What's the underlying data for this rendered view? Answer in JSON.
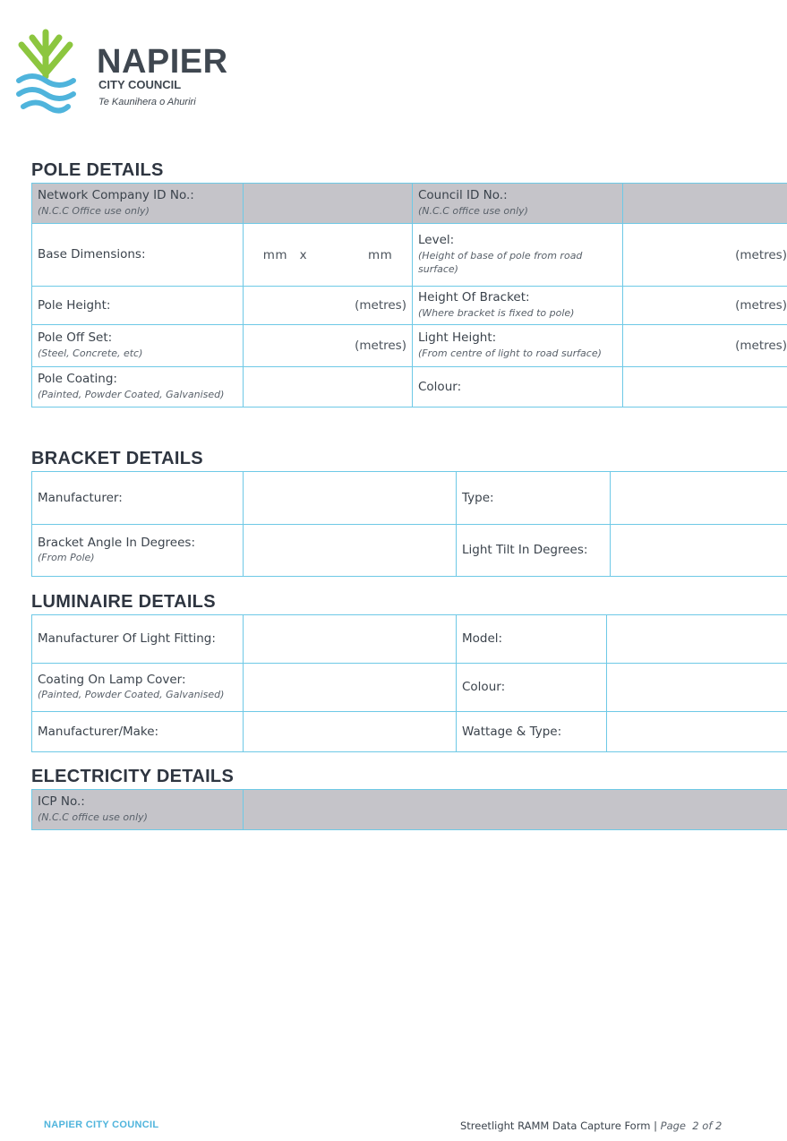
{
  "logo": {
    "name": "NAPIER",
    "sub": "CITY COUNCIL",
    "maori": "Te Kaunihera o Ahuriri",
    "colors": {
      "leaf": "#8cc63f",
      "wave": "#4fb4dc",
      "text": "#3f4750"
    }
  },
  "pole": {
    "title": "POLE DETAILS",
    "network_id": {
      "label": "Network Company ID No.:",
      "sub": "(N.C.C Office use only)"
    },
    "council_id": {
      "label": "Council ID No.:",
      "sub": "(N.C.C office use only)"
    },
    "base_dimensions": {
      "label": "Base Dimensions:",
      "value": "mm  x          mm"
    },
    "level": {
      "label": "Level:",
      "sub": "(Height of base of pole from road surface)",
      "unit": "(metres)"
    },
    "pole_height": {
      "label": "Pole Height:",
      "unit": "(metres)"
    },
    "bracket_height": {
      "label": "Height Of Bracket:",
      "sub": "(Where bracket is fixed to pole)",
      "unit": "(metres)"
    },
    "pole_offset": {
      "label": "Pole Off Set:",
      "sub": "(Steel, Concrete, etc)",
      "unit": "(metres)"
    },
    "light_height": {
      "label": "Light Height:",
      "sub": "(From centre of light to road surface)",
      "unit": "(metres)"
    },
    "pole_coating": {
      "label": "Pole Coating:",
      "sub": "(Painted, Powder Coated, Galvanised)"
    },
    "colour": {
      "label": "Colour:"
    }
  },
  "bracket": {
    "title": "BRACKET DETAILS",
    "manufacturer": {
      "label": "Manufacturer:"
    },
    "type": {
      "label": "Type:"
    },
    "angle": {
      "label": "Bracket Angle In Degrees:",
      "sub": "(From Pole)"
    },
    "tilt": {
      "label": "Light Tilt In Degrees:"
    }
  },
  "luminaire": {
    "title": "LUMINAIRE DETAILS",
    "manufacturer_fitting": {
      "label": "Manufacturer Of Light Fitting:"
    },
    "model": {
      "label": "Model:"
    },
    "coating": {
      "label": "Coating On Lamp Cover:",
      "sub": "(Painted, Powder Coated, Galvanised)"
    },
    "colour": {
      "label": "Colour:"
    },
    "make": {
      "label": "Manufacturer/Make:"
    },
    "wattage": {
      "label": "Wattage & Type:"
    }
  },
  "electricity": {
    "title": "ELECTRICITY DETAILS",
    "icp": {
      "label": "ICP No.:",
      "sub": "(N.C.C office use only)"
    }
  },
  "footer": {
    "org": "NAPIER CITY COUNCIL",
    "form_name": "Streetlight RAMM Data Capture Form |",
    "page": "Page  2 of 2"
  }
}
